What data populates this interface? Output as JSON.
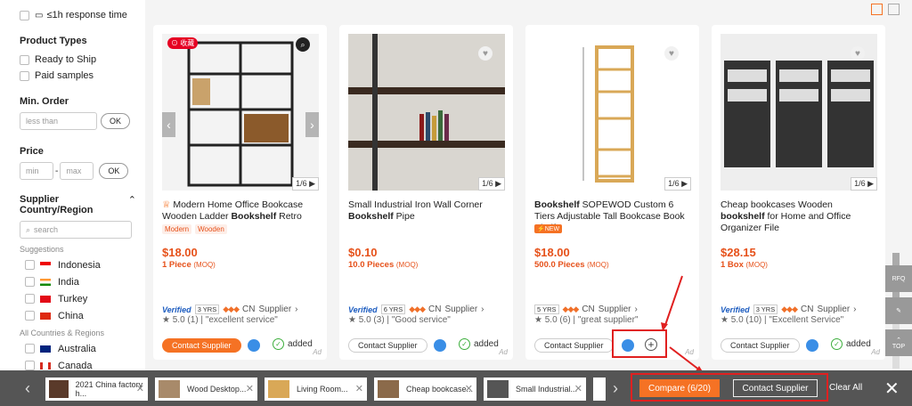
{
  "sidebar": {
    "response_time": "≤1h response time",
    "product_types_title": "Product Types",
    "ready_to_ship": "Ready to Ship",
    "paid_samples": "Paid samples",
    "min_order_title": "Min. Order",
    "min_order_placeholder": "less than",
    "ok_label": "OK",
    "price_title": "Price",
    "price_min_placeholder": "min",
    "price_sep": "-",
    "price_max_placeholder": "max",
    "supplier_country_title": "Supplier Country/Region",
    "search_placeholder": "search",
    "suggestions_label": "Suggestions",
    "countries": [
      "Indonesia",
      "India",
      "Turkey",
      "China"
    ],
    "all_countries_label": "All Countries & Regions",
    "all_countries": [
      "Australia",
      "Canada"
    ]
  },
  "cards": [
    {
      "pin": "收藏",
      "title_pre": "Modern Home Office Bookcase Wooden Ladder ",
      "title_bold": "Bookshelf",
      "title_post": " Retro",
      "tags": [
        "Modern",
        "Wooden"
      ],
      "price": "$18.00",
      "moq_qty": "1 Piece",
      "moq_label": "(MOQ)",
      "verified": "Verified",
      "years": "3 YRS",
      "country": "CN",
      "supplier": "Supplier",
      "rating": "5.0 (1)",
      "review": "\"excellent service\"",
      "contact": "Contact Supplier",
      "added": "added",
      "counter": "1/6",
      "ad": "Ad"
    },
    {
      "title_pre": "Small Industrial Iron Wall Corner ",
      "title_bold": "Bookshelf",
      "title_post": " Pipe",
      "price": "$0.10",
      "moq_qty": "10.0 Pieces",
      "moq_label": "(MOQ)",
      "verified": "Verified",
      "years": "6 YRS",
      "country": "CN",
      "supplier": "Supplier",
      "rating": "5.0 (3)",
      "review": "\"Good service\"",
      "contact": "Contact Supplier",
      "added": "added",
      "counter": "1/6",
      "ad": "Ad"
    },
    {
      "title_pre": "",
      "title_bold": "Bookshelf",
      "title_post": " SOPEWOD Custom 6 Tiers Adjustable Tall Bookcase Book Shelf",
      "new_badge": "NEW",
      "price": "$18.00",
      "moq_qty": "500.0 Pieces",
      "moq_label": "(MOQ)",
      "years": "5 YRS",
      "country": "CN",
      "supplier": "Supplier",
      "rating": "5.0 (6)",
      "review": "\"great supplier\"",
      "contact": "Contact Supplier",
      "counter": "1/6",
      "ad": "Ad"
    },
    {
      "title_pre": "Cheap bookcases Wooden ",
      "title_bold": "bookshelf",
      "title_post": " for Home and Office Organizer File",
      "price": "$28.15",
      "moq_qty": "1 Box",
      "moq_label": "(MOQ)",
      "verified": "Verified",
      "years": "3 YRS",
      "country": "CN",
      "supplier": "Supplier",
      "rating": "5.0 (10)",
      "review": "\"Excellent Service\"",
      "contact": "Contact Supplier",
      "added": "added",
      "counter": "1/6",
      "ad": "Ad"
    }
  ],
  "float": {
    "rfq": "RFQ",
    "top": "TOP"
  },
  "compare_bar": {
    "items": [
      "2021 China factory h...",
      "Wood Desktop...",
      "Living Room...",
      "Cheap bookcase...",
      "Small Industrial..."
    ],
    "compare_label": "Compare (6/20)",
    "contact_label": "Contact Supplier",
    "clear_label": "Clear All"
  },
  "colors": {
    "accent": "#f57224",
    "highlight": "#e02020",
    "bar": "#555555"
  }
}
